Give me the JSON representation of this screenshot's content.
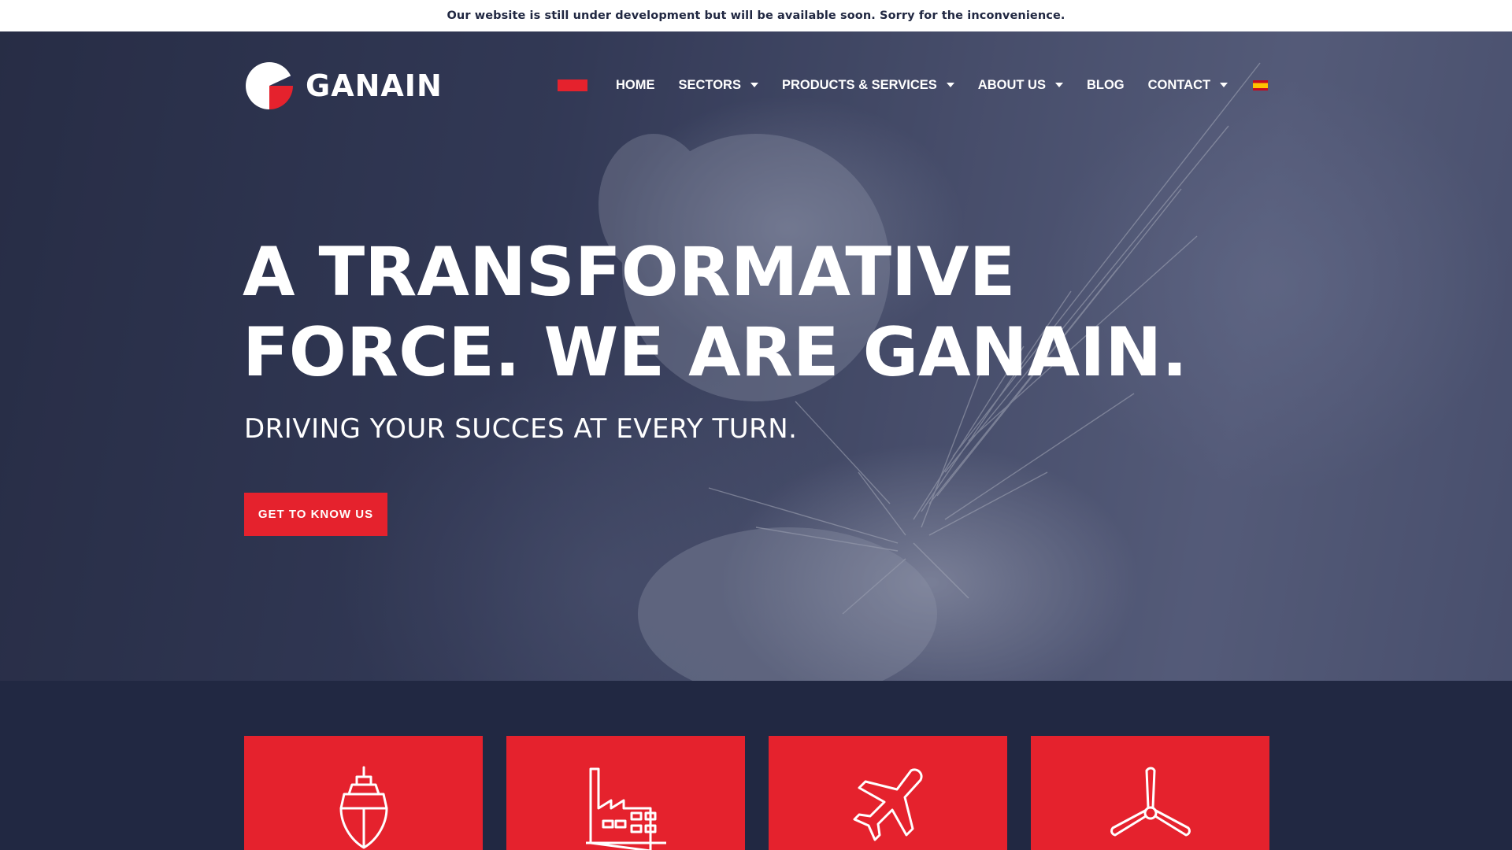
{
  "notice": {
    "text": "Our website is still under development but will be available soon. Sorry for the inconvenience."
  },
  "brand": {
    "name": "GANAIN",
    "accent": "#e5222d",
    "navy": "#212842"
  },
  "nav": {
    "items": [
      {
        "label": "HOME",
        "dropdown": false
      },
      {
        "label": "SECTORS",
        "dropdown": true
      },
      {
        "label": "PRODUCTS & SERVICES",
        "dropdown": true
      },
      {
        "label": "ABOUT US",
        "dropdown": true
      },
      {
        "label": "BLOG",
        "dropdown": false
      },
      {
        "label": "CONTACT",
        "dropdown": true
      }
    ],
    "language_icon": "spain-flag-icon"
  },
  "hero": {
    "title_line1": "A TRANSFORMATIVE",
    "title_line2": "FORCE. WE ARE GANAIN.",
    "subtitle": "DRIVING YOUR SUCCES AT EVERY TURN.",
    "cta_label": "GET TO KNOW US"
  },
  "sectors": [
    {
      "icon": "ship-icon"
    },
    {
      "icon": "factory-icon"
    },
    {
      "icon": "airplane-icon"
    },
    {
      "icon": "wind-turbine-icon"
    }
  ]
}
